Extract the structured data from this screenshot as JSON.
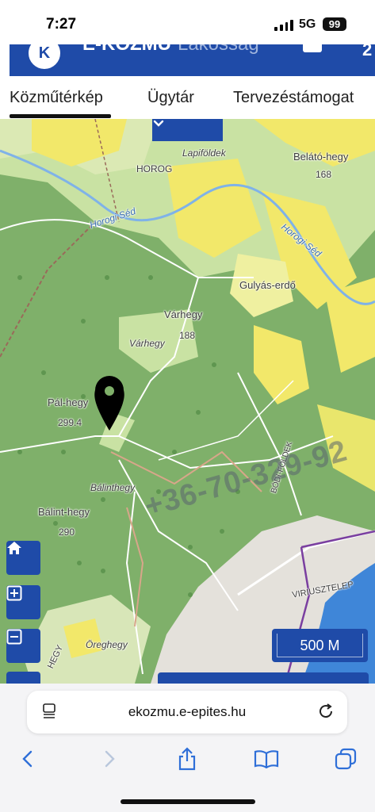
{
  "status_bar": {
    "time": "7:27",
    "network": "5G",
    "battery": "99"
  },
  "app": {
    "title_bold": "E-KÖZMŰ",
    "title_rest": "Lakosság",
    "logo_letter": "K"
  },
  "tabs": [
    {
      "label": "Közműtérkép",
      "active": true
    },
    {
      "label": "Ügytár",
      "active": false
    },
    {
      "label": "Tervezéstámogat",
      "active": false
    }
  ],
  "map": {
    "labels": {
      "lapifoldek": "Lapiföldek",
      "horog": "HOROG",
      "belato_hegy": "Belátó-hegy",
      "belato_elev": "168",
      "horogi_sed_1": "Horogi Séd",
      "horogi_sed_2": "Horogi Séd",
      "gulyas_erdo": "Gulyás-erdő",
      "varhegy_1": "Várhegy",
      "varhegy_elev": "188",
      "varhegy_2": "Várhegy",
      "pal_hegy": "Pál-hegy",
      "pal_elev": "299.4",
      "balinthegy": "Bálinthegy",
      "balint_hegy": "Bálint-hegy",
      "balint_elev": "290",
      "bodi_foldek": "BÓDI-FÖLDEK",
      "viriusztelep": "VIRIUSZTELEP",
      "oreghegy": "Öreghegy",
      "hegy": "HEGY"
    },
    "watermark": "+36-70-329-92",
    "scale": "500 M"
  },
  "controls": {
    "home": "home-icon",
    "zoom_in": "zoom-in-icon",
    "zoom_out": "zoom-out-icon",
    "expand": "chevron-down-icon"
  },
  "browser": {
    "url": "ekozmu.e-epites.hu"
  },
  "colors": {
    "brand": "#1f4ba8",
    "forest": "#7fb06a",
    "field": "#f2e86a",
    "water": "#3f86d8"
  }
}
